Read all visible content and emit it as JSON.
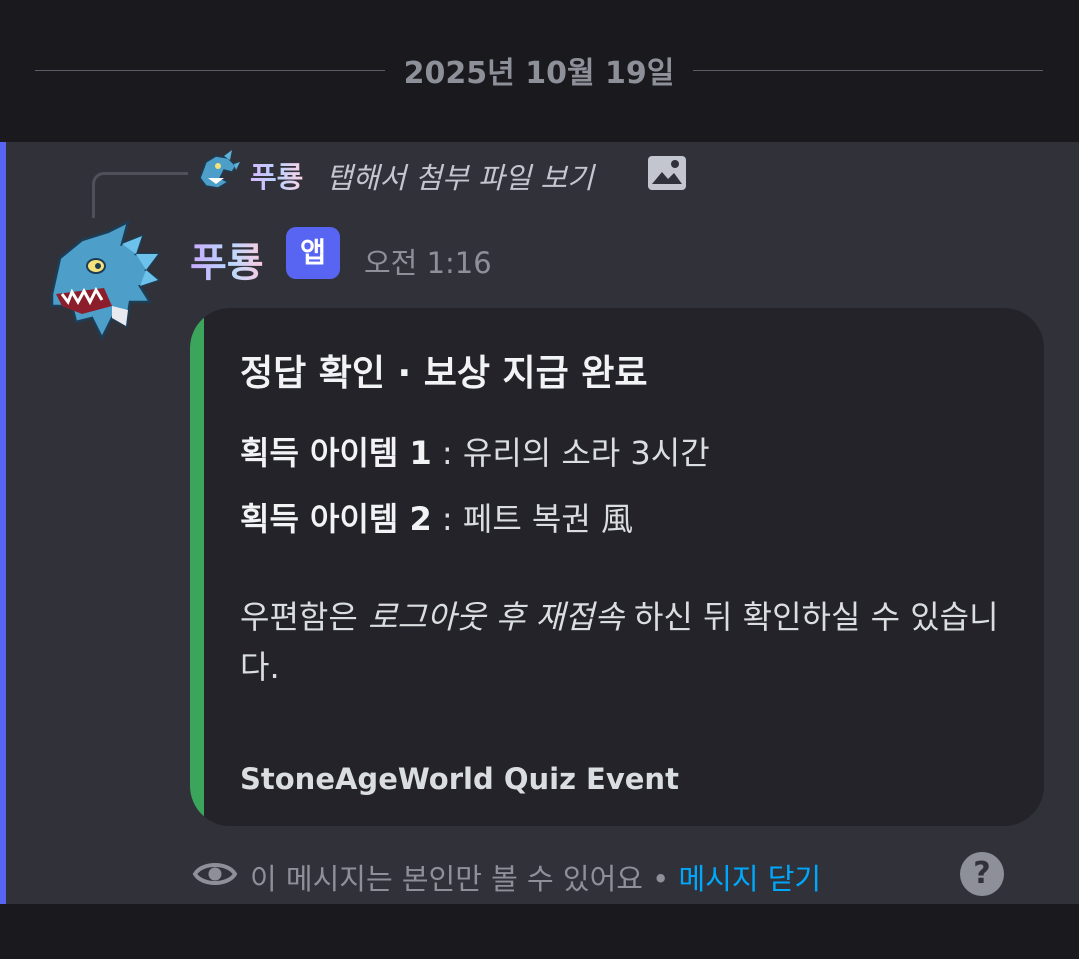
{
  "divider": {
    "date": "2025년 10월 19일"
  },
  "reply": {
    "author": "푸룡",
    "text": "탭해서 첨부 파일 보기"
  },
  "message": {
    "author": "푸룡",
    "badge": "앱",
    "timestamp": "오전 1:16"
  },
  "embed": {
    "title": "정답 확인 · 보상 지급 완료",
    "field1_label": "획득 아이템 1",
    "field1_value": " : 유리의 소라 3시간",
    "field2_label": "획득 아이템 2",
    "field2_value": " : 페트 복권 風",
    "desc_before": "우편함은 ",
    "desc_italic": "로그아웃 후 재접속",
    "desc_after": " 하신 뒤 확인하실 수 있습니다.",
    "footer": "StoneAgeWorld Quiz Event",
    "accent_color": "#3ba55c"
  },
  "ephemeral": {
    "notice": "이 메시지는 본인만 볼 수 있어요",
    "separator": " • ",
    "dismiss": "메시지 닫기",
    "help": "?"
  },
  "icons": {
    "reply_attachment": "image-icon",
    "visibility": "eye-icon",
    "help": "question-circle-icon"
  },
  "colors": {
    "background": "#1a1a1e",
    "message_highlight": "#31313a",
    "mention_accent": "#5865f2",
    "link": "#00a8fc"
  }
}
